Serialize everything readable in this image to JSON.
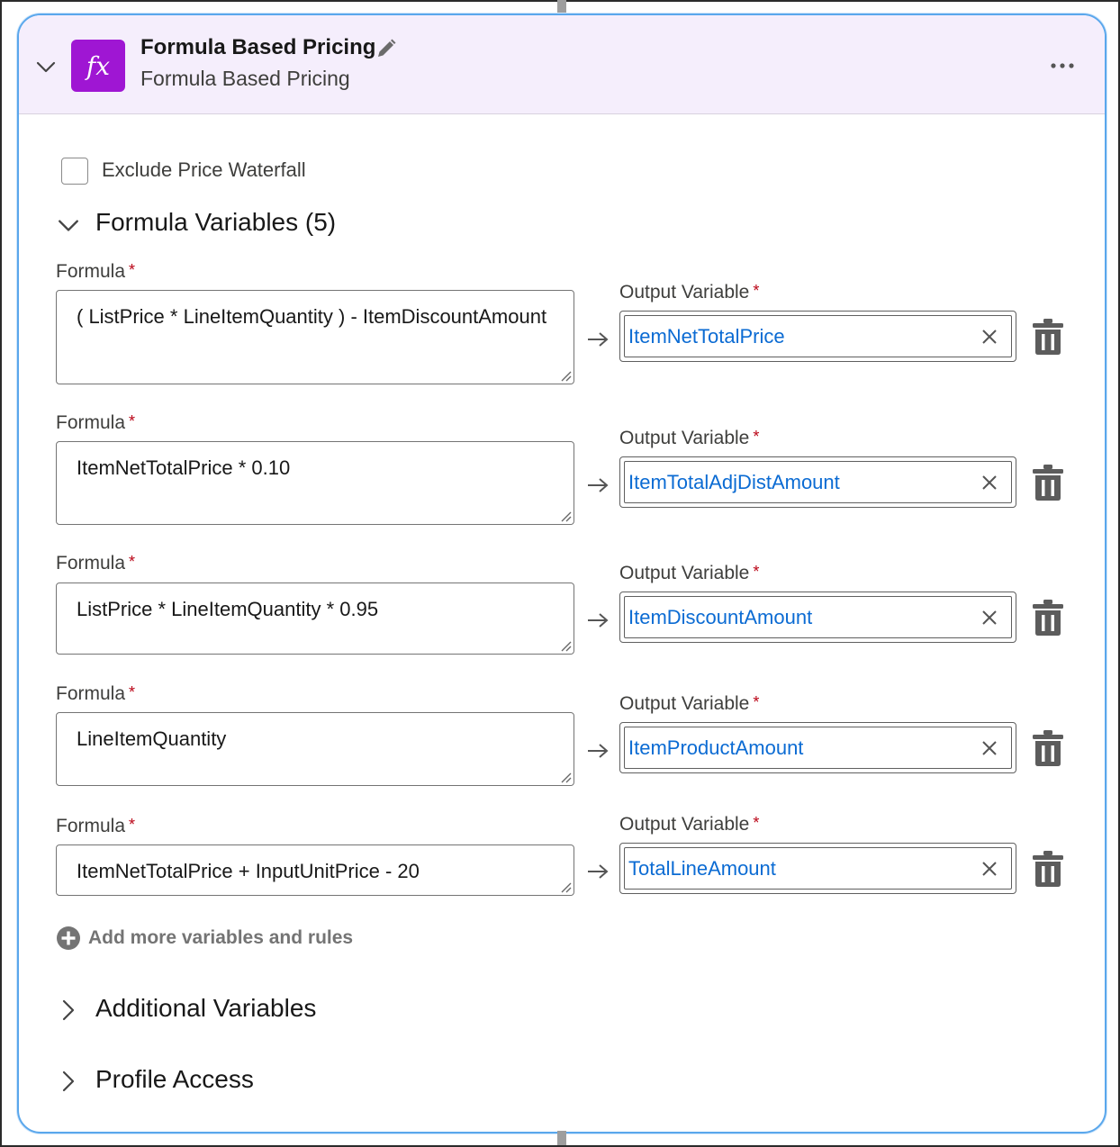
{
  "header": {
    "badge_symbol": "fx",
    "title": "Formula Based Pricing",
    "subtitle": "Formula Based Pricing"
  },
  "exclude_waterfall": {
    "label": "Exclude Price Waterfall",
    "checked": false
  },
  "formula_section": {
    "title": "Formula Variables (5)",
    "formula_label": "Formula",
    "output_label": "Output Variable",
    "required_marker": "*",
    "rows": [
      {
        "formula": "( ListPrice * LineItemQuantity ) - ItemDiscountAmount",
        "output": "ItemNetTotalPrice"
      },
      {
        "formula": "ItemNetTotalPrice * 0.10",
        "output": "ItemTotalAdjDistAmount"
      },
      {
        "formula": "ListPrice * LineItemQuantity * 0.95",
        "output": "ItemDiscountAmount"
      },
      {
        "formula": "LineItemQuantity",
        "output": "ItemProductAmount"
      },
      {
        "formula": "ItemNetTotalPrice + InputUnitPrice - 20",
        "output": "TotalLineAmount"
      }
    ],
    "add_more_label": "Add more variables and rules"
  },
  "additional_variables": {
    "title": "Additional Variables"
  },
  "profile_access": {
    "title": "Profile Access"
  },
  "colors": {
    "accent": "#9f16d3",
    "header_bg": "#f5eefc",
    "card_border": "#5aa7ec",
    "output_text": "#0b6bd3",
    "required": "#ba0517"
  }
}
